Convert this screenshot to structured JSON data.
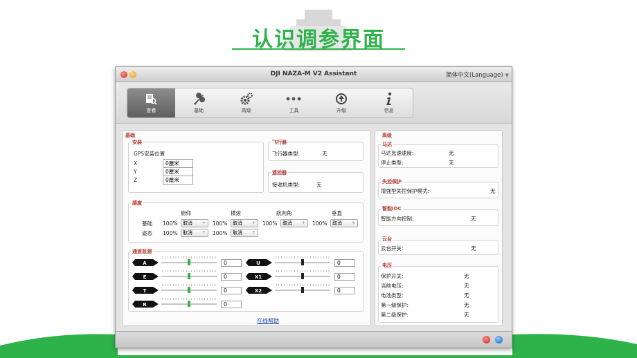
{
  "slide": {
    "title": "认识调参界面"
  },
  "window": {
    "title": "DJI NAZA-M V2 Assistant",
    "language": "简体中文(Language)"
  },
  "toolbar": {
    "items": [
      {
        "label": "查看",
        "icon": "view-icon"
      },
      {
        "label": "基础",
        "icon": "wrench-icon"
      },
      {
        "label": "高级",
        "icon": "gears-icon"
      },
      {
        "label": "工具",
        "icon": "dots-icon"
      },
      {
        "label": "升级",
        "icon": "upgrade-icon"
      },
      {
        "label": "信息",
        "icon": "info-icon"
      }
    ]
  },
  "basic": {
    "title": "基础",
    "mount": {
      "title": "安装",
      "gps_label": "GPS安装位置",
      "rows": [
        {
          "axis": "X",
          "value": "0厘米"
        },
        {
          "axis": "Y",
          "value": "0厘米"
        },
        {
          "axis": "Z",
          "value": "0厘米"
        }
      ]
    },
    "aircraft": {
      "title": "飞行器",
      "label": "飞行器类型:",
      "value": "无"
    },
    "remote": {
      "title": "遥控器",
      "label": "接收机类型:",
      "value": "无"
    },
    "gain": {
      "title": "感度",
      "headers": [
        "俯仰",
        "横滚",
        "航向角",
        "垂直"
      ],
      "rows": [
        {
          "label": "基础",
          "cells": [
            {
              "pct": "100%",
              "sel": "取消"
            },
            {
              "pct": "100%",
              "sel": "取消"
            },
            {
              "pct": "100%",
              "sel": "取消"
            },
            {
              "pct": "100%",
              "sel": "取消"
            }
          ]
        },
        {
          "label": "姿态",
          "cells": [
            {
              "pct": "100%",
              "sel": "取消"
            },
            {
              "pct": "100%",
              "sel": "取消"
            }
          ]
        }
      ]
    },
    "channels": {
      "title": "通道监测",
      "left": [
        {
          "name": "A",
          "value": "0"
        },
        {
          "name": "E",
          "value": "0"
        },
        {
          "name": "T",
          "value": "0"
        },
        {
          "name": "R",
          "value": "0"
        }
      ],
      "right": [
        {
          "name": "U",
          "value": "0"
        },
        {
          "name": "X1",
          "value": "0"
        },
        {
          "name": "X2",
          "value": "0"
        }
      ]
    },
    "help_link": "在线帮助"
  },
  "advanced": {
    "title": "高级",
    "motor": {
      "title": "马达",
      "rows": [
        {
          "label": "马达怠速速度:",
          "value": "无"
        },
        {
          "label": "停止类型:",
          "value": "无"
        }
      ]
    },
    "failsafe": {
      "title": "失控保护",
      "rows": [
        {
          "label": "增强型失控保护模式:",
          "value": "无"
        }
      ]
    },
    "ioc": {
      "title": "智能IOC",
      "rows": [
        {
          "label": "智能方向控制:",
          "value": "无"
        }
      ]
    },
    "gimbal": {
      "title": "云台",
      "rows": [
        {
          "label": "云台开关:",
          "value": "无"
        }
      ]
    },
    "voltage": {
      "title": "电压",
      "rows": [
        {
          "label": "保护开关:",
          "value": "无"
        },
        {
          "label": "当前电压:",
          "value": "无"
        },
        {
          "label": "电池类型:",
          "value": "无"
        },
        {
          "label": "第一级保护:",
          "value": "无"
        },
        {
          "label": "第二级保护:",
          "value": "无"
        }
      ]
    }
  },
  "colors": {
    "accent_green": "#2db34a",
    "section_red": "#b03a2e",
    "link_blue": "#1f4aa8"
  }
}
